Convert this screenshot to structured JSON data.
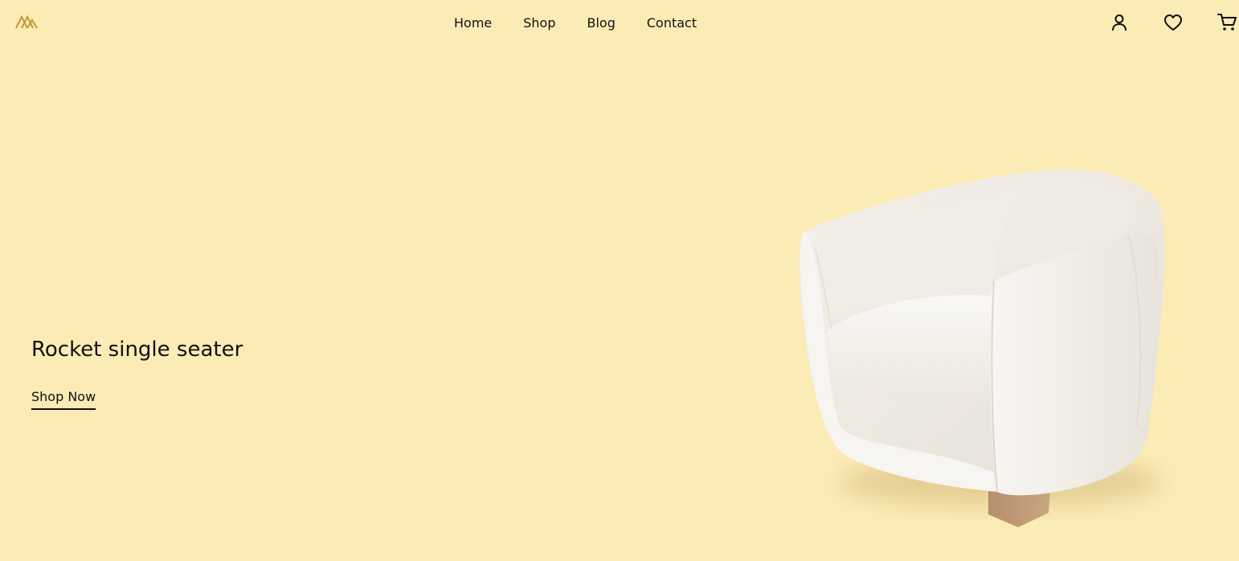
{
  "header": {
    "logo_icon": "logo-mark-icon",
    "nav": [
      {
        "label": "Home"
      },
      {
        "label": "Shop"
      },
      {
        "label": "Blog"
      },
      {
        "label": "Contact"
      }
    ],
    "icons": [
      "user-icon",
      "heart-icon",
      "cart-icon"
    ]
  },
  "hero": {
    "title": "Rocket single seater",
    "cta_label": "Shop Now",
    "image": "white-armchair"
  },
  "colors": {
    "background": "#fbebb5",
    "accent": "#c49a3a",
    "text": "#111111"
  }
}
